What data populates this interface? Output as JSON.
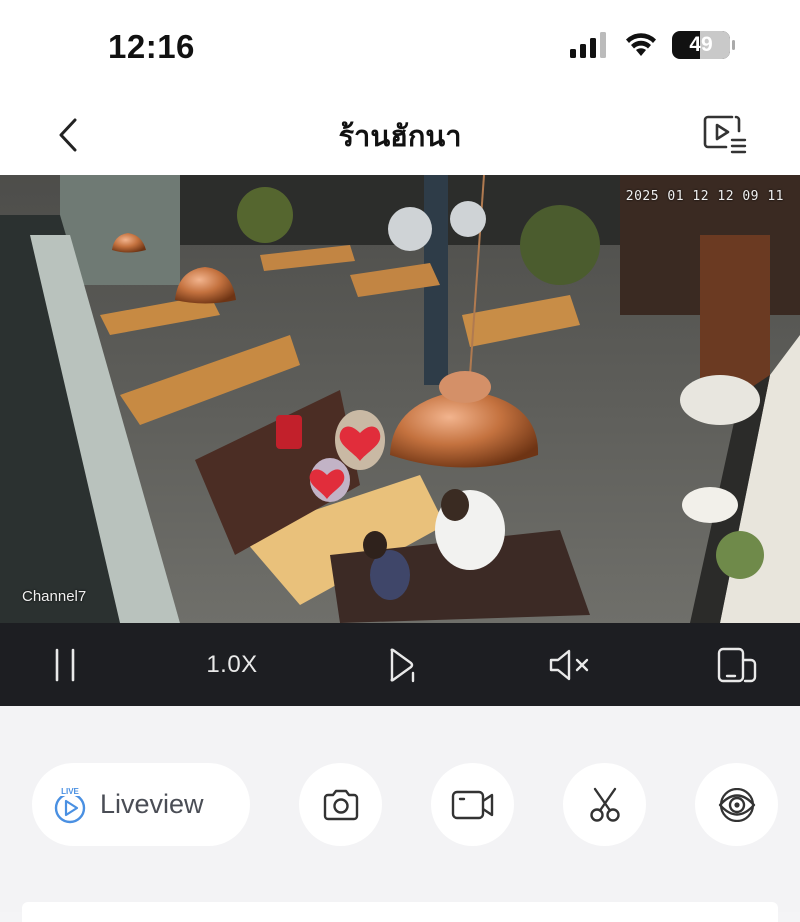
{
  "status_bar": {
    "time": "12:16",
    "battery_level": "49",
    "battery_fraction": 0.49
  },
  "nav": {
    "title": "ร้านฮักนา"
  },
  "video": {
    "timestamp": "2025 01 12 12 09 11",
    "channel": "Channel7"
  },
  "playback_controls": {
    "speed": "1.0X"
  },
  "actions": {
    "liveview_label": "Liveview",
    "live_badge": "LIVE"
  },
  "colors": {
    "accent": "#4a90e2",
    "controls_bg": "#1d1e22",
    "panel_bg": "#f3f3f5"
  }
}
